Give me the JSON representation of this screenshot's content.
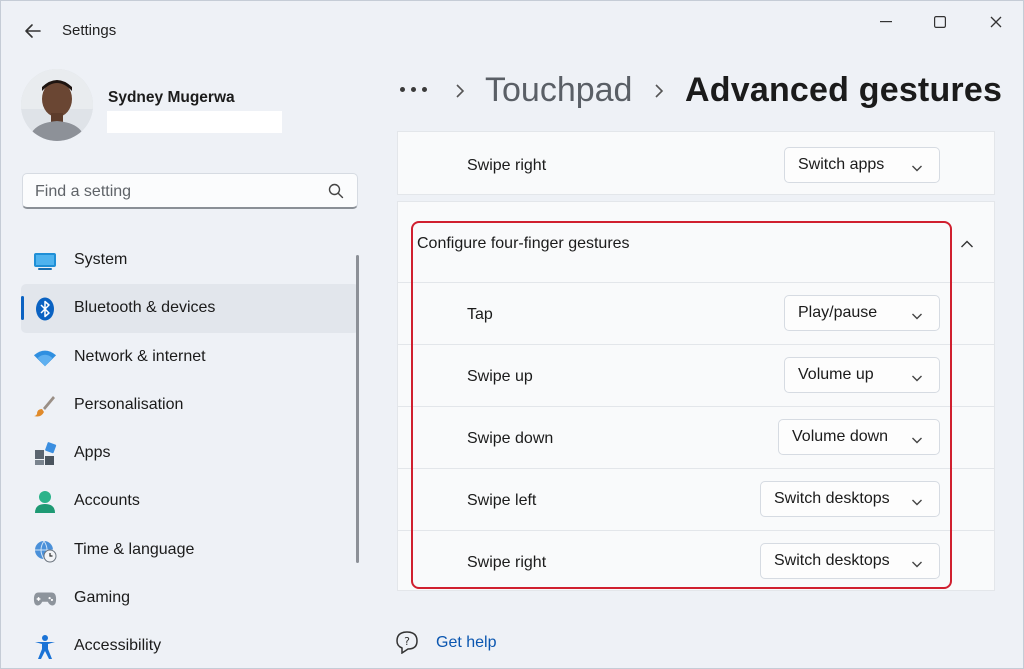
{
  "window": {
    "title": "Settings",
    "icons": {
      "back": "back-arrow-icon",
      "minimize": "minimize-icon",
      "maximize": "maximize-icon",
      "close": "close-icon"
    }
  },
  "user": {
    "name": "Sydney Mugerwa",
    "email": ""
  },
  "search": {
    "placeholder": "Find a setting",
    "icon": "search-icon"
  },
  "sidebar": {
    "active_index": 1,
    "items": [
      {
        "label": "System",
        "icon": "system-monitor-icon"
      },
      {
        "label": "Bluetooth & devices",
        "icon": "bluetooth-icon"
      },
      {
        "label": "Network & internet",
        "icon": "wifi-icon"
      },
      {
        "label": "Personalisation",
        "icon": "paintbrush-icon"
      },
      {
        "label": "Apps",
        "icon": "apps-icon"
      },
      {
        "label": "Accounts",
        "icon": "accounts-person-icon"
      },
      {
        "label": "Time & language",
        "icon": "globe-clock-icon"
      },
      {
        "label": "Gaming",
        "icon": "gamepad-icon"
      },
      {
        "label": "Accessibility",
        "icon": "accessibility-icon"
      }
    ]
  },
  "breadcrumb": {
    "overflow": "more-icon",
    "parent": "Touchpad",
    "current": "Advanced gestures"
  },
  "three_finger": {
    "row": {
      "label": "Swipe right",
      "value": "Switch apps"
    }
  },
  "four_finger": {
    "title": "Configure four-finger gestures",
    "expanded": true,
    "rows": [
      {
        "label": "Tap",
        "value": "Play/pause"
      },
      {
        "label": "Swipe up",
        "value": "Volume up"
      },
      {
        "label": "Swipe down",
        "value": "Volume down"
      },
      {
        "label": "Swipe left",
        "value": "Switch desktops"
      },
      {
        "label": "Swipe right",
        "value": "Switch desktops"
      }
    ]
  },
  "help": {
    "label": "Get help",
    "icon": "help-chat-icon"
  },
  "colors": {
    "accent": "#0a62c2",
    "highlight": "#d01f2f",
    "link": "#0a56b0"
  }
}
